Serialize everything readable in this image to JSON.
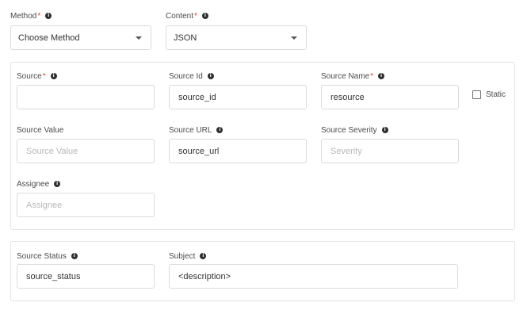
{
  "method": {
    "label": "Method",
    "required_mark": "*",
    "value": "Choose Method"
  },
  "content": {
    "label": "Content",
    "required_mark": "*",
    "value": "JSON"
  },
  "source": {
    "label": "Source",
    "required_mark": "*",
    "value": {
      "label": "Source Value",
      "placeholder": "Source Value"
    },
    "id": {
      "label": "Source Id",
      "value": "source_id"
    },
    "name": {
      "label": "Source Name",
      "required_mark": "*",
      "value": "resource"
    },
    "static": {
      "label": "Static",
      "checked": false
    },
    "url": {
      "label": "Source URL",
      "value": "source_url"
    },
    "severity": {
      "label": "Source Severity",
      "placeholder": "Severity"
    },
    "assignee": {
      "label": "Assignee",
      "placeholder": "Assignee"
    }
  },
  "status_panel": {
    "status": {
      "label": "Source Status",
      "value": "source_status"
    },
    "subject": {
      "label": "Subject",
      "value": "<description>"
    }
  },
  "info_icon_glyph": "i"
}
